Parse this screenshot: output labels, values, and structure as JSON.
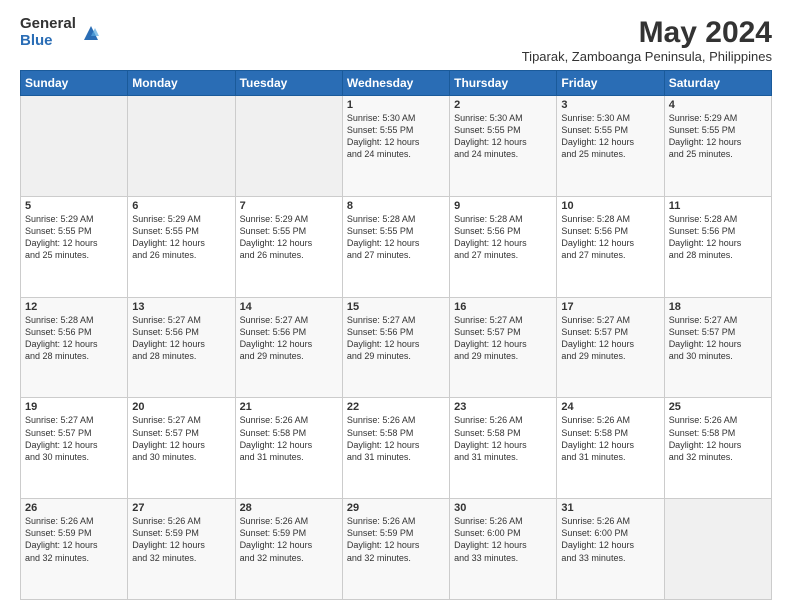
{
  "logo": {
    "general": "General",
    "blue": "Blue"
  },
  "title": "May 2024",
  "subtitle": "Tiparak, Zamboanga Peninsula, Philippines",
  "days": [
    "Sunday",
    "Monday",
    "Tuesday",
    "Wednesday",
    "Thursday",
    "Friday",
    "Saturday"
  ],
  "weeks": [
    [
      {
        "day": "",
        "content": ""
      },
      {
        "day": "",
        "content": ""
      },
      {
        "day": "",
        "content": ""
      },
      {
        "day": "1",
        "content": "Sunrise: 5:30 AM\nSunset: 5:55 PM\nDaylight: 12 hours\nand 24 minutes."
      },
      {
        "day": "2",
        "content": "Sunrise: 5:30 AM\nSunset: 5:55 PM\nDaylight: 12 hours\nand 24 minutes."
      },
      {
        "day": "3",
        "content": "Sunrise: 5:30 AM\nSunset: 5:55 PM\nDaylight: 12 hours\nand 25 minutes."
      },
      {
        "day": "4",
        "content": "Sunrise: 5:29 AM\nSunset: 5:55 PM\nDaylight: 12 hours\nand 25 minutes."
      }
    ],
    [
      {
        "day": "5",
        "content": "Sunrise: 5:29 AM\nSunset: 5:55 PM\nDaylight: 12 hours\nand 25 minutes."
      },
      {
        "day": "6",
        "content": "Sunrise: 5:29 AM\nSunset: 5:55 PM\nDaylight: 12 hours\nand 26 minutes."
      },
      {
        "day": "7",
        "content": "Sunrise: 5:29 AM\nSunset: 5:55 PM\nDaylight: 12 hours\nand 26 minutes."
      },
      {
        "day": "8",
        "content": "Sunrise: 5:28 AM\nSunset: 5:55 PM\nDaylight: 12 hours\nand 27 minutes."
      },
      {
        "day": "9",
        "content": "Sunrise: 5:28 AM\nSunset: 5:56 PM\nDaylight: 12 hours\nand 27 minutes."
      },
      {
        "day": "10",
        "content": "Sunrise: 5:28 AM\nSunset: 5:56 PM\nDaylight: 12 hours\nand 27 minutes."
      },
      {
        "day": "11",
        "content": "Sunrise: 5:28 AM\nSunset: 5:56 PM\nDaylight: 12 hours\nand 28 minutes."
      }
    ],
    [
      {
        "day": "12",
        "content": "Sunrise: 5:28 AM\nSunset: 5:56 PM\nDaylight: 12 hours\nand 28 minutes."
      },
      {
        "day": "13",
        "content": "Sunrise: 5:27 AM\nSunset: 5:56 PM\nDaylight: 12 hours\nand 28 minutes."
      },
      {
        "day": "14",
        "content": "Sunrise: 5:27 AM\nSunset: 5:56 PM\nDaylight: 12 hours\nand 29 minutes."
      },
      {
        "day": "15",
        "content": "Sunrise: 5:27 AM\nSunset: 5:56 PM\nDaylight: 12 hours\nand 29 minutes."
      },
      {
        "day": "16",
        "content": "Sunrise: 5:27 AM\nSunset: 5:57 PM\nDaylight: 12 hours\nand 29 minutes."
      },
      {
        "day": "17",
        "content": "Sunrise: 5:27 AM\nSunset: 5:57 PM\nDaylight: 12 hours\nand 29 minutes."
      },
      {
        "day": "18",
        "content": "Sunrise: 5:27 AM\nSunset: 5:57 PM\nDaylight: 12 hours\nand 30 minutes."
      }
    ],
    [
      {
        "day": "19",
        "content": "Sunrise: 5:27 AM\nSunset: 5:57 PM\nDaylight: 12 hours\nand 30 minutes."
      },
      {
        "day": "20",
        "content": "Sunrise: 5:27 AM\nSunset: 5:57 PM\nDaylight: 12 hours\nand 30 minutes."
      },
      {
        "day": "21",
        "content": "Sunrise: 5:26 AM\nSunset: 5:58 PM\nDaylight: 12 hours\nand 31 minutes."
      },
      {
        "day": "22",
        "content": "Sunrise: 5:26 AM\nSunset: 5:58 PM\nDaylight: 12 hours\nand 31 minutes."
      },
      {
        "day": "23",
        "content": "Sunrise: 5:26 AM\nSunset: 5:58 PM\nDaylight: 12 hours\nand 31 minutes."
      },
      {
        "day": "24",
        "content": "Sunrise: 5:26 AM\nSunset: 5:58 PM\nDaylight: 12 hours\nand 31 minutes."
      },
      {
        "day": "25",
        "content": "Sunrise: 5:26 AM\nSunset: 5:58 PM\nDaylight: 12 hours\nand 32 minutes."
      }
    ],
    [
      {
        "day": "26",
        "content": "Sunrise: 5:26 AM\nSunset: 5:59 PM\nDaylight: 12 hours\nand 32 minutes."
      },
      {
        "day": "27",
        "content": "Sunrise: 5:26 AM\nSunset: 5:59 PM\nDaylight: 12 hours\nand 32 minutes."
      },
      {
        "day": "28",
        "content": "Sunrise: 5:26 AM\nSunset: 5:59 PM\nDaylight: 12 hours\nand 32 minutes."
      },
      {
        "day": "29",
        "content": "Sunrise: 5:26 AM\nSunset: 5:59 PM\nDaylight: 12 hours\nand 32 minutes."
      },
      {
        "day": "30",
        "content": "Sunrise: 5:26 AM\nSunset: 6:00 PM\nDaylight: 12 hours\nand 33 minutes."
      },
      {
        "day": "31",
        "content": "Sunrise: 5:26 AM\nSunset: 6:00 PM\nDaylight: 12 hours\nand 33 minutes."
      },
      {
        "day": "",
        "content": ""
      }
    ]
  ]
}
